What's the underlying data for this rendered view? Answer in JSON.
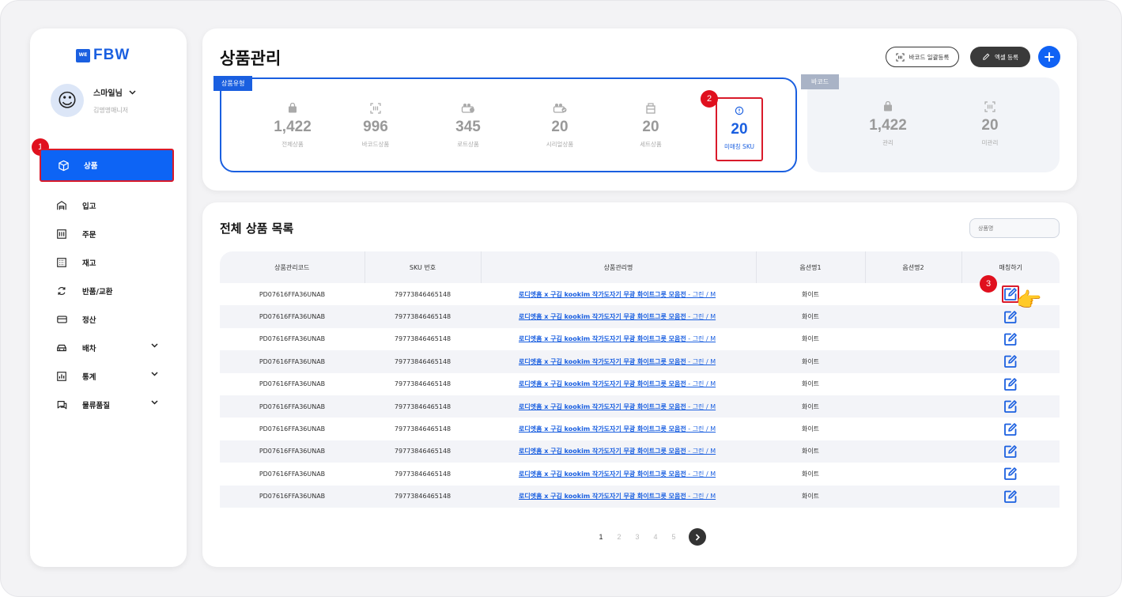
{
  "brand": {
    "logo_text": "FBW",
    "badge_text": "WE"
  },
  "profile": {
    "name": "스마일님",
    "role": "김명명매니저",
    "avatar_emoji": "☺"
  },
  "sidebar": {
    "items": [
      {
        "label": "상품",
        "icon": "box-icon"
      },
      {
        "label": "입고",
        "icon": "warehouse-icon"
      },
      {
        "label": "주문",
        "icon": "order-icon"
      },
      {
        "label": "재고",
        "icon": "grid-icon"
      },
      {
        "label": "반품/교환",
        "icon": "refresh-icon"
      },
      {
        "label": "정산",
        "icon": "card-icon"
      },
      {
        "label": "배차",
        "icon": "car-icon"
      },
      {
        "label": "통계",
        "icon": "chart-icon"
      },
      {
        "label": "물류품질",
        "icon": "chat-icon"
      }
    ]
  },
  "markers": {
    "one": "1",
    "two": "2",
    "three": "3"
  },
  "header": {
    "title": "상품관리",
    "barcode_bulk_label": "바코드 일괄등록",
    "excel_label": "엑셀 등록",
    "add_label": "+"
  },
  "product_types": {
    "tag": "상품유형",
    "stats": [
      {
        "value": "1,422",
        "label": "전체상품",
        "icon": "bag-icon"
      },
      {
        "value": "996",
        "label": "바코드상품",
        "icon": "barcode-scan-icon"
      },
      {
        "value": "345",
        "label": "로트상품",
        "icon": "lot-icon"
      },
      {
        "value": "20",
        "label": "시리얼상품",
        "icon": "serial-icon"
      },
      {
        "value": "20",
        "label": "세트상품",
        "icon": "set-icon"
      },
      {
        "value": "20",
        "label": "미매칭 SKU",
        "icon": "alert-circle-icon"
      }
    ]
  },
  "barcode": {
    "tag": "바코드",
    "stats": [
      {
        "value": "1,422",
        "label": "관리",
        "icon": "bag-icon"
      },
      {
        "value": "20",
        "label": "미관리",
        "icon": "barcode-scan-icon"
      }
    ]
  },
  "list": {
    "title": "전체 상품 목록",
    "search_placeholder": "상품명",
    "columns": [
      "상품관리코드",
      "SKU 번호",
      "상품관리명",
      "옵션명1",
      "옵션명2",
      "매칭하기"
    ],
    "rows": [
      {
        "code": "PD07616FFA36UNAB",
        "sku": "79773846465148",
        "name": "로디엣홈 x 구김 kookim 작가도자기 무광 화이트그릇 모음전",
        "name_suffix": " - 그린 / M",
        "opt1": "화이트",
        "opt2": ""
      },
      {
        "code": "PD07616FFA36UNAB",
        "sku": "79773846465148",
        "name": "로디엣홈 x 구김 kookim 작가도자기 무광 화이트그릇 모음전",
        "name_suffix": " - 그린 / M",
        "opt1": "화이트",
        "opt2": ""
      },
      {
        "code": "PD07616FFA36UNAB",
        "sku": "79773846465148",
        "name": "로디엣홈 x 구김 kookim 작가도자기 무광 화이트그릇 모음전",
        "name_suffix": " - 그린 / M",
        "opt1": "화이트",
        "opt2": ""
      },
      {
        "code": "PD07616FFA36UNAB",
        "sku": "79773846465148",
        "name": "로디엣홈 x 구김 kookim 작가도자기 무광 화이트그릇 모음전",
        "name_suffix": " - 그린 / M",
        "opt1": "화이트",
        "opt2": ""
      },
      {
        "code": "PD07616FFA36UNAB",
        "sku": "79773846465148",
        "name": "로디엣홈 x 구김 kookim 작가도자기 무광 화이트그릇 모음전",
        "name_suffix": " - 그린 / M",
        "opt1": "화이트",
        "opt2": ""
      },
      {
        "code": "PD07616FFA36UNAB",
        "sku": "79773846465148",
        "name": "로디엣홈 x 구김 kookim 작가도자기 무광 화이트그릇 모음전",
        "name_suffix": " - 그린 / M",
        "opt1": "화이트",
        "opt2": ""
      },
      {
        "code": "PD07616FFA36UNAB",
        "sku": "79773846465148",
        "name": "로디엣홈 x 구김 kookim 작가도자기 무광 화이트그릇 모음전",
        "name_suffix": " - 그린 / M",
        "opt1": "화이트",
        "opt2": ""
      },
      {
        "code": "PD07616FFA36UNAB",
        "sku": "79773846465148",
        "name": "로디엣홈 x 구김 kookim 작가도자기 무광 화이트그릇 모음전",
        "name_suffix": " - 그린 / M",
        "opt1": "화이트",
        "opt2": ""
      },
      {
        "code": "PD07616FFA36UNAB",
        "sku": "79773846465148",
        "name": "로디엣홈 x 구김 kookim 작가도자기 무광 화이트그릇 모음전",
        "name_suffix": " - 그린 / M",
        "opt1": "화이트",
        "opt2": ""
      },
      {
        "code": "PD07616FFA36UNAB",
        "sku": "79773846465148",
        "name": "로디엣홈 x 구김 kookim 작가도자기 무광 화이트그릇 모음전",
        "name_suffix": " - 그린 / M",
        "opt1": "화이트",
        "opt2": ""
      }
    ]
  },
  "pagination": {
    "pages": [
      "1",
      "2",
      "3",
      "4",
      "5"
    ],
    "current": "1"
  },
  "colors": {
    "primary": "#1a5fe0",
    "marker_red": "#e0101e",
    "highlight_border": "#d91a2a",
    "muted": "#999999"
  },
  "pointer": {
    "emoji": "👉"
  }
}
